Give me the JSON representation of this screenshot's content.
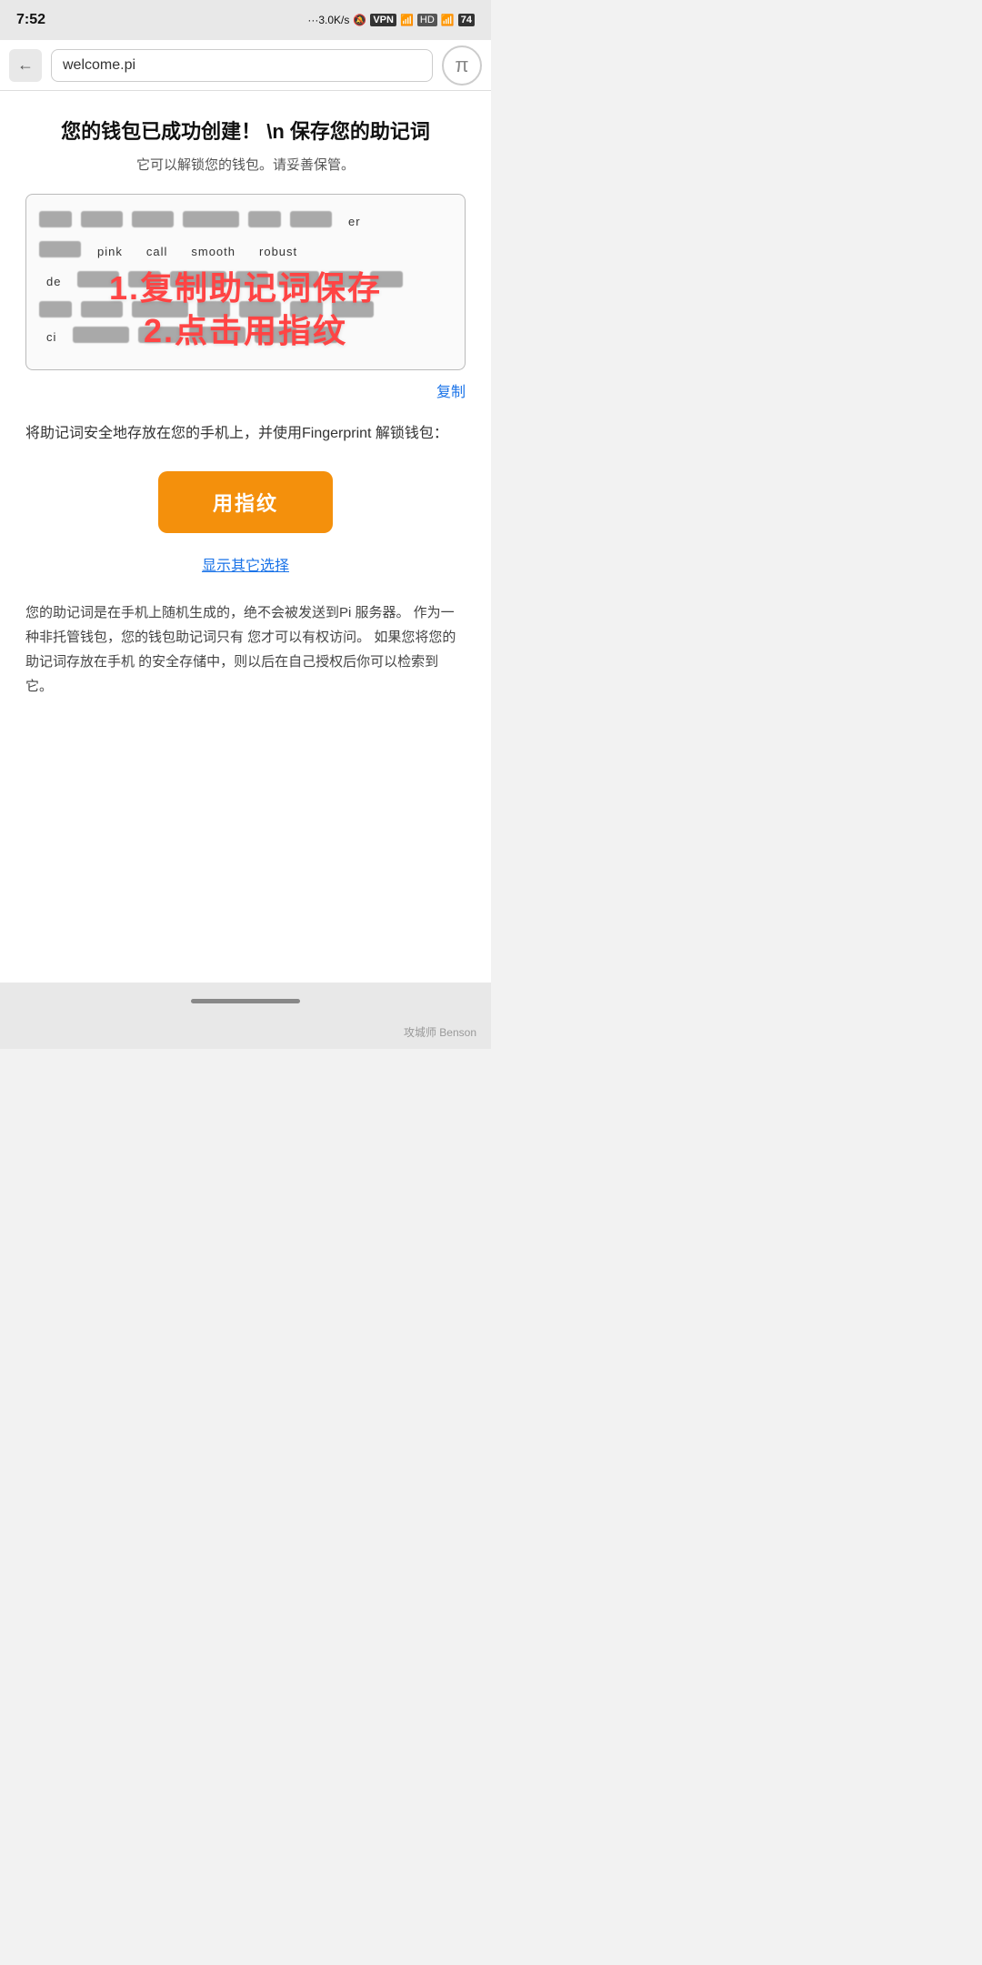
{
  "status_bar": {
    "time": "7:52",
    "network": "···3.0K/s",
    "vpn": "VPN",
    "signal1": "4G",
    "hd": "HD",
    "signal2": "4G",
    "battery": "74"
  },
  "browser": {
    "back_label": "‹",
    "url": "welcome.pi",
    "logo_symbol": "π"
  },
  "page": {
    "title": "您的钱包已成功创建！ \\n 保存您的助记词",
    "subtitle": "它可以解锁您的钱包。请妥善保管。",
    "mnemonic_visible_words": [
      "pink",
      "call",
      "smooth",
      "robust"
    ],
    "overlay_line1": "1.复制助记词保存",
    "overlay_line2": "2.点击用指纹",
    "copy_label": "复制",
    "fingerprint_desc": "将助记词安全地存放在您的手机上，并使用Fingerprint 解锁钱包：",
    "fingerprint_btn_label": "用指纹",
    "show_options_label": "显示其它选择",
    "bottom_note": "您的助记词是在手机上随机生成的，绝不会被发送到Pi 服务器。 作为一种非托管钱包，您的钱包助记词只有 您才可以有权访问。 如果您将您的助记词存放在手机 的安全存储中，则以后在自己授权后你可以检索到 它。",
    "watermark": "攻城师 Benson"
  },
  "colors": {
    "orange": "#f4900c",
    "blue_link": "#1a73e8",
    "red_overlay": "#ff4444",
    "mnemonic_border": "#bbb"
  }
}
